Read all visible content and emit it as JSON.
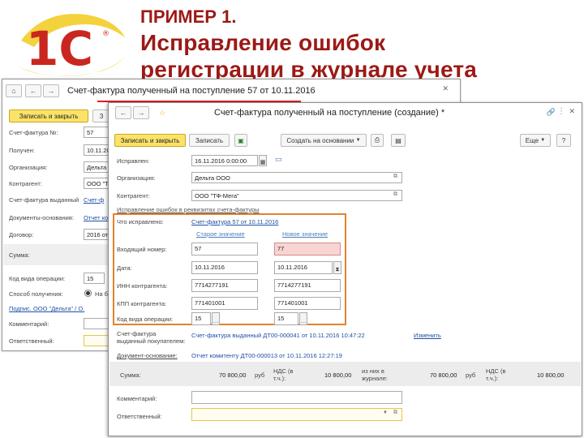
{
  "slide": {
    "title_line1": "ПРИМЕР 1.",
    "title_line2": "Исправление ошибок",
    "title_line3": "регистрации в журнале учета"
  },
  "logo": {
    "text": "1С"
  },
  "back_window": {
    "title_a": "Счет-фактура полученный на поступление 57",
    "title_b": " от 10.11.2016",
    "btn_save_close": "Записать и закрыть",
    "btn_write": "З",
    "labels": [
      "Счет-фактура №:",
      "Получен:",
      "Организация:",
      "Контрагент:",
      "Счет-фактура выданный",
      "Документы-основания:",
      "Договор:",
      "Сумма:",
      "Код вида операции:",
      "Способ получения:",
      "Подписи",
      "Комментарий:",
      "Ответственный:"
    ],
    "values": {
      "number": "57",
      "received": "10.11.20",
      "org": "Дельта",
      "contractor": "ООО \"Т",
      "contract": "2016 от",
      "op_code": "15",
      "invoice_link": "Счет-ф",
      "basis_link": "Отчет ко",
      "method": "На б",
      "signature_link": "Подпис. ООО \"Дельта\" / О."
    }
  },
  "front_window": {
    "title": "Счет-фактура полученный на поступление (создание) *",
    "btn_save_close": "Записать и закрыть",
    "btn_write": "Записать",
    "btn_create_basis": "Создать на основании",
    "btn_more": "Еще",
    "btn_help": "?",
    "fixed_label": "Исправлен:",
    "fixed_value": "16.11.2016 0:00:00",
    "org_label": "Организация:",
    "org_value": "Дельта ООО",
    "contractor_label": "Контрагент:",
    "contractor_value": "ООО \"ТФ-Мега\"",
    "section_hint": "Исправление ошибок в реквизитах счета-фактуры",
    "what_fixed_label": "Что исправлено:",
    "what_fixed_link": "Счет-фактура 57 от 10.11.2016",
    "col_old": "Старое значение",
    "col_new": "Новое значение",
    "rows": [
      {
        "label": "Входящий номер:",
        "old": "57",
        "new": "77"
      },
      {
        "label": "Дата:",
        "old": "10.11.2016",
        "new": "10.11.2016"
      },
      {
        "label": "ИНН контрагента:",
        "old": "7714277191",
        "new": "7714277191"
      },
      {
        "label": "КПП контрагента:",
        "old": "771401001",
        "new": "771401001"
      },
      {
        "label": "Код вида операции:",
        "old": "15",
        "new": "15"
      }
    ],
    "issued_label_1": "Счет-фактура",
    "issued_label_2": "выданный покупателем:",
    "issued_value": "Счет-фактура выданный ДТ00-000041 от 10.11.2016 10:47:22",
    "issued_change": "Изменить",
    "basis_label": "Документ-основание:",
    "basis_value": "Отчет комитенту ДТ00-000013 от 10.11.2016 12:27:19",
    "sum_label": "Сумма:",
    "sum1": "70 800,00",
    "cur1": "руб",
    "vat_label": "НДС (в т.ч.):",
    "vat1": "10 800,00",
    "journal_label": "из них в журнале:",
    "sum2": "70 800,00",
    "cur2": "руб",
    "vat_label2": "НДС (в т.ч.):",
    "vat2": "10 800,00",
    "comment_label": "Комментарий:",
    "responsible_label": "Ответственный:"
  }
}
